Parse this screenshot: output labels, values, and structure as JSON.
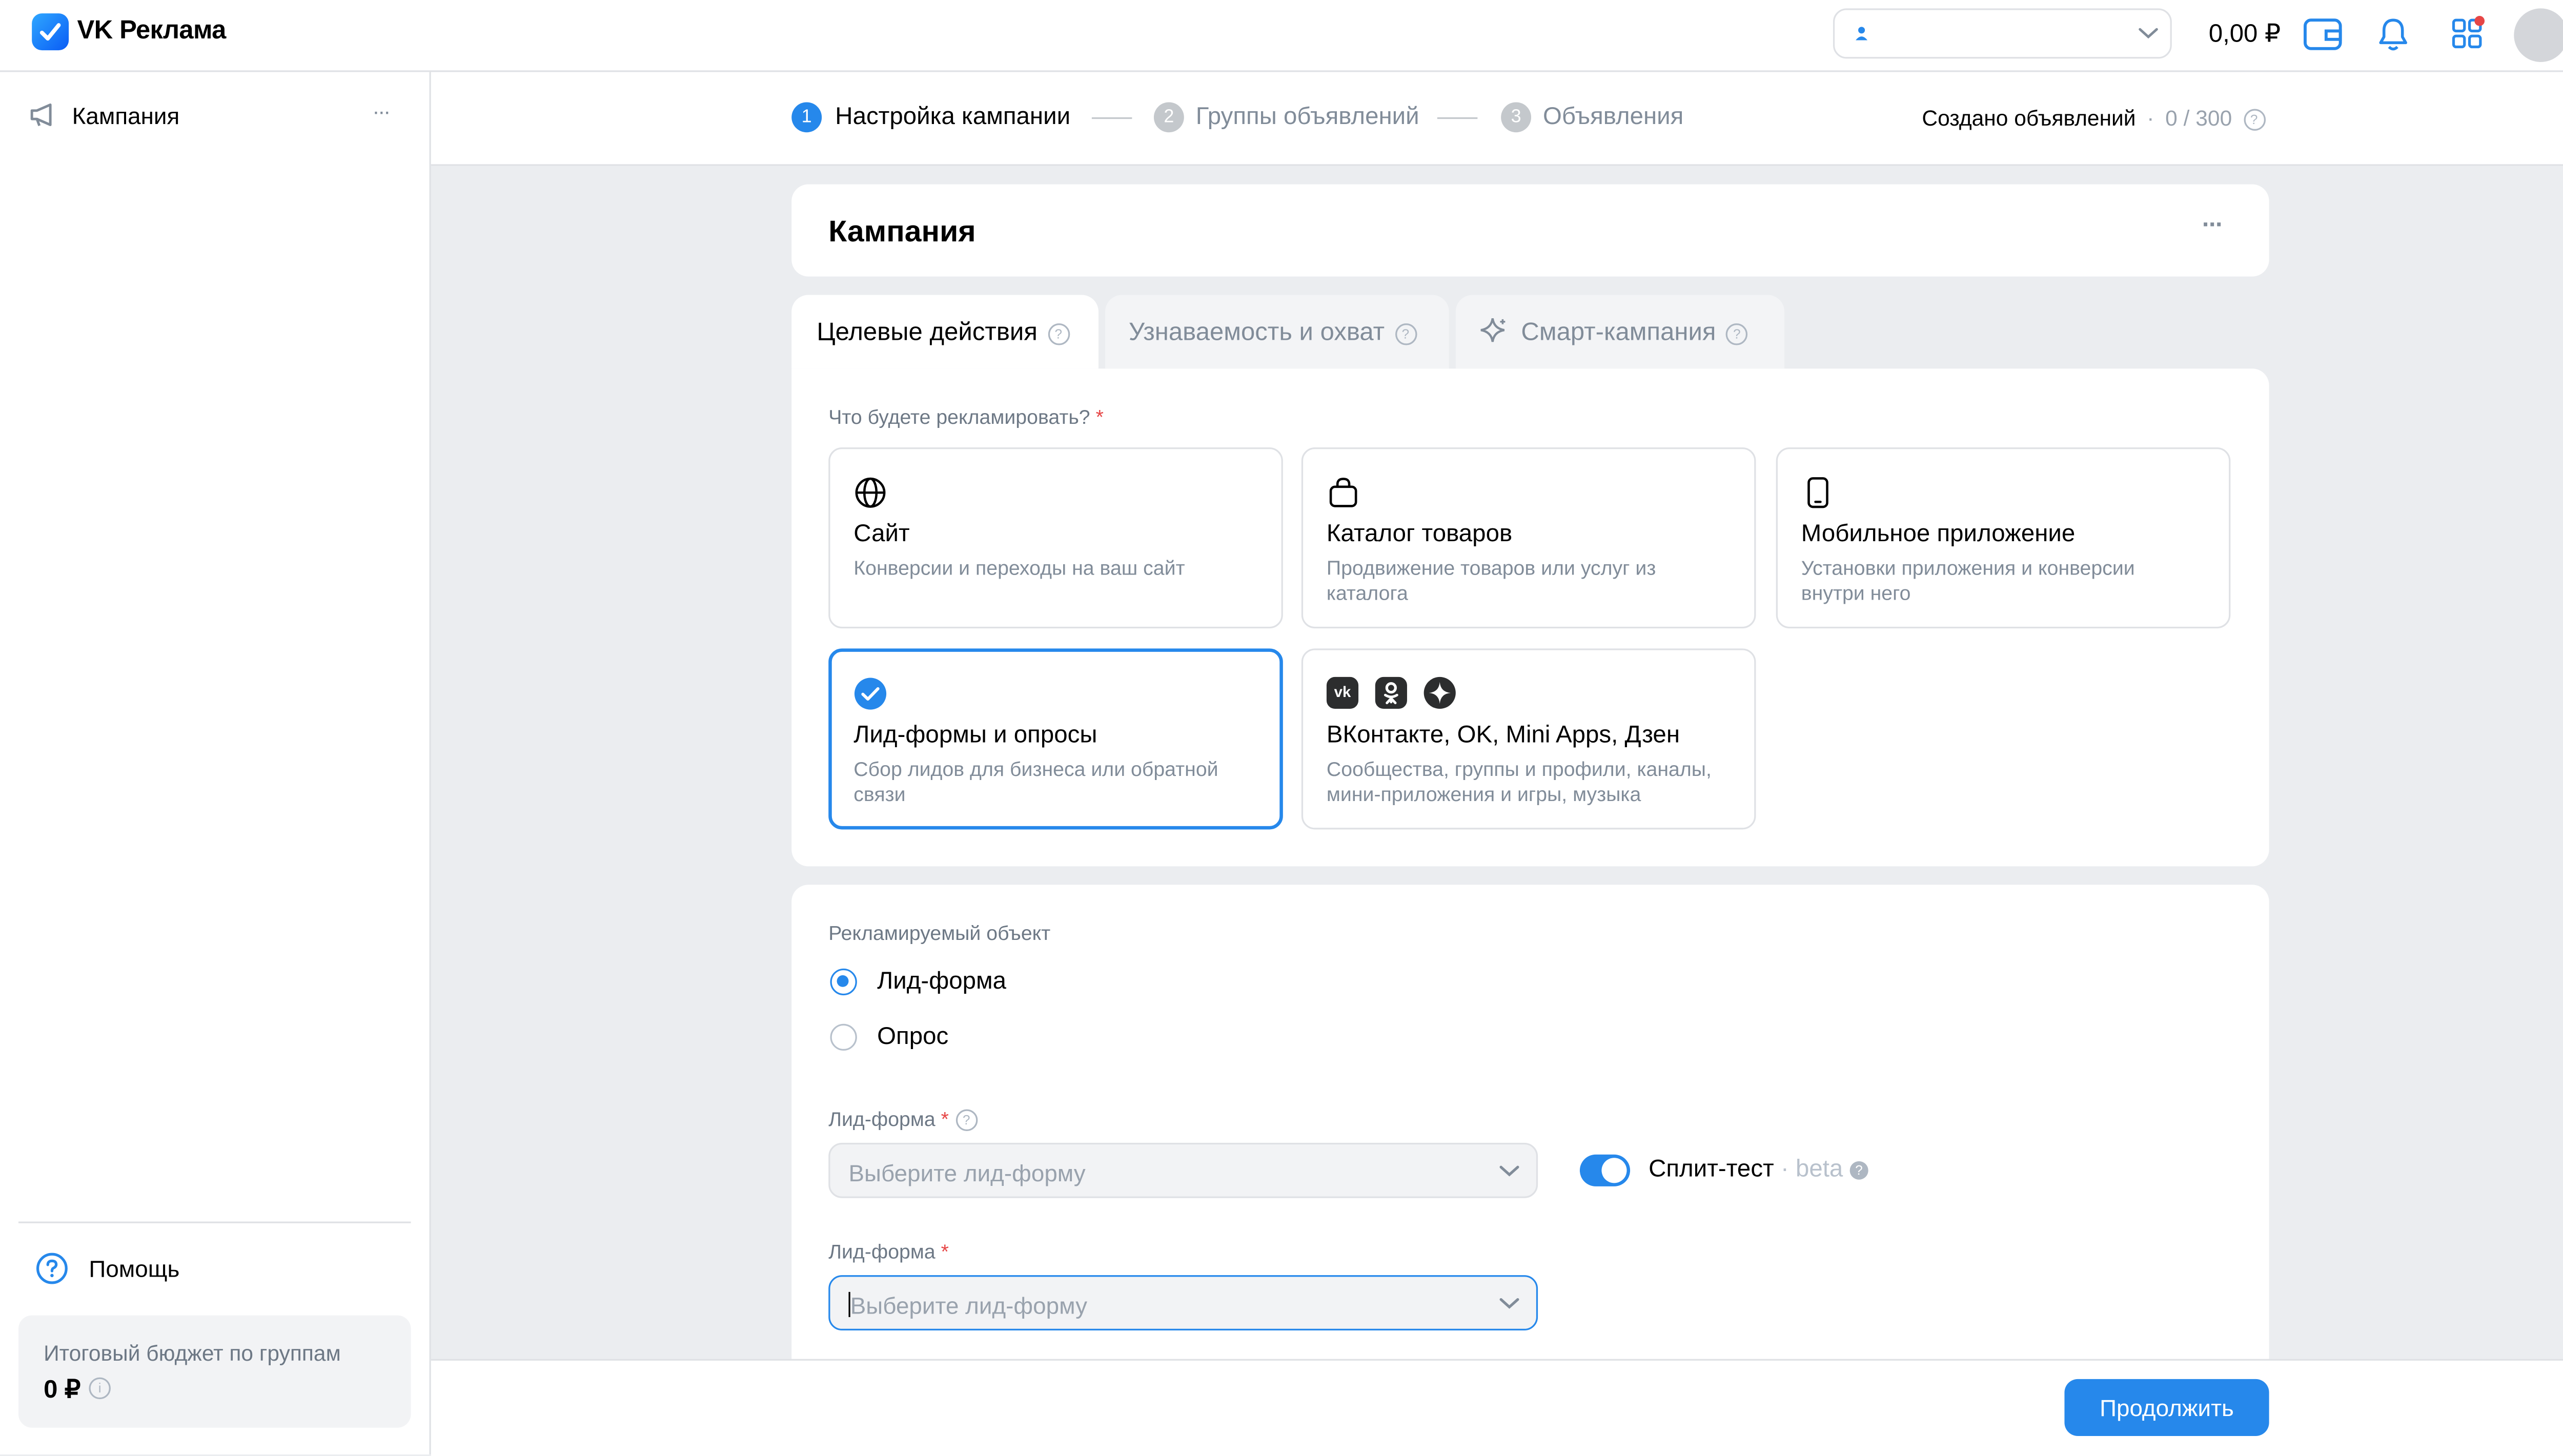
{
  "app": {
    "title": "VK Реклама",
    "balance": "0,00 ₽"
  },
  "sidebar": {
    "campaign_label": "Кампания",
    "more": "···",
    "help_label": "Помощь",
    "budget_label": "Итоговый бюджет по группам",
    "budget_value": "0 ₽"
  },
  "steps": [
    {
      "num": "1",
      "label": "Настройка кампании",
      "active": true
    },
    {
      "num": "2",
      "label": "Группы объявлений",
      "active": false
    },
    {
      "num": "3",
      "label": "Объявления",
      "active": false
    }
  ],
  "created_ads": {
    "label": "Создано объявлений",
    "sep": "·",
    "value": "0 / 300"
  },
  "campaign": {
    "title": "Кампания",
    "more": "···"
  },
  "tabs": [
    {
      "label": "Целевые действия",
      "active": true
    },
    {
      "label": "Узнаваемость и охват",
      "active": false
    },
    {
      "label": "Смарт-кампания",
      "active": false
    }
  ],
  "advertise": {
    "question": "Что будете рекламировать?",
    "required_mark": "*",
    "options": [
      {
        "title": "Сайт",
        "desc": "Конверсии и переходы на ваш сайт",
        "icon": "globe-icon"
      },
      {
        "title": "Каталог товаров",
        "desc": "Продвижение товаров или услуг из каталога",
        "icon": "shopping-bag-icon"
      },
      {
        "title": "Мобильное приложение",
        "desc": "Установки приложения и конверсии внутри него",
        "icon": "smartphone-icon"
      },
      {
        "title": "Лид-формы и опросы",
        "desc": "Сбор лидов для бизнеса или обратной связи",
        "icon": "check-circle-icon",
        "selected": true
      },
      {
        "title": "ВКонтакте, OK, Mini Apps, Дзен",
        "desc": "Сообщества, группы и профили, каналы, мини-приложения и игры, музыка",
        "icon": "vk-ok-dzen-icons"
      }
    ]
  },
  "object": {
    "label": "Рекламируемый объект",
    "radios": [
      {
        "label": "Лид-форма",
        "checked": true
      },
      {
        "label": "Опрос",
        "checked": false
      }
    ]
  },
  "leadform": {
    "label": "Лид-форма",
    "placeholder": "Выберите лид-форму",
    "label2": "Лид-форма",
    "placeholder2": "Выберите лид-форму"
  },
  "split_test": {
    "label": "Сплит-тест",
    "beta": "· beta",
    "enabled": true
  },
  "footer": {
    "continue_label": "Продолжить"
  },
  "colors": {
    "accent": "#2688eb",
    "bg": "#ebedf0",
    "required": "#e64646"
  }
}
